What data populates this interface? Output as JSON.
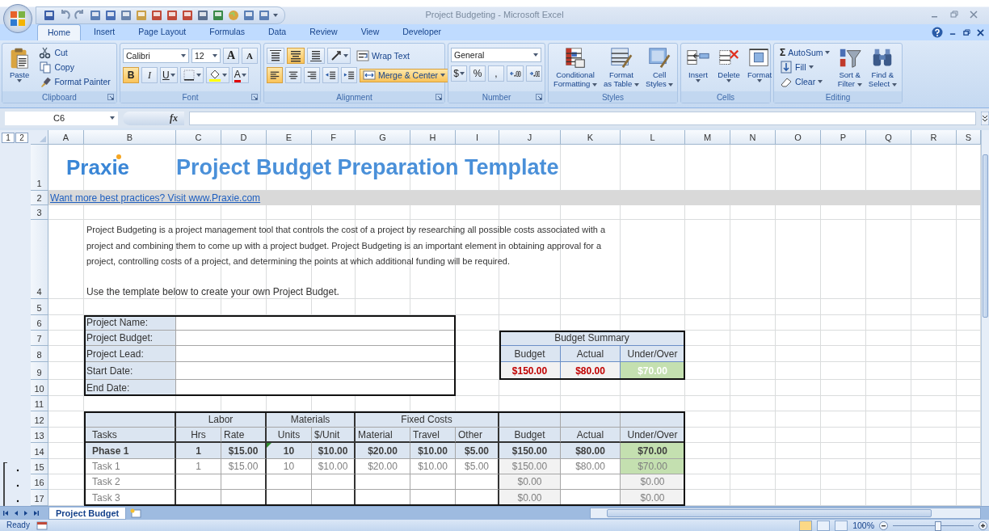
{
  "window": {
    "title": "Project Budgeting - Microsoft Excel"
  },
  "ribbon_tabs": [
    {
      "label": "Home",
      "selected": true
    },
    {
      "label": "Insert",
      "selected": false
    },
    {
      "label": "Page Layout",
      "selected": false
    },
    {
      "label": "Formulas",
      "selected": false
    },
    {
      "label": "Data",
      "selected": false
    },
    {
      "label": "Review",
      "selected": false
    },
    {
      "label": "View",
      "selected": false
    },
    {
      "label": "Developer",
      "selected": false
    }
  ],
  "ribbon": {
    "groups": [
      {
        "label": "Clipboard",
        "launcher": true,
        "sections": [
          [
            {
              "kind": "large",
              "lines": [
                "Paste"
              ],
              "dropdown": true
            }
          ],
          [
            {
              "kind": "small",
              "label": "Cut"
            },
            {
              "kind": "small",
              "label": "Copy"
            },
            {
              "kind": "small",
              "label": "Format Painter"
            }
          ]
        ]
      },
      {
        "label": "Font",
        "launcher": true,
        "sections": [
          [
            {
              "kind": "combo",
              "value": "Calibri"
            },
            {
              "kind": "combo",
              "value": "12"
            },
            {
              "kind": "glyph",
              "text": "A"
            },
            {
              "kind": "glyph",
              "text": "A"
            }
          ],
          [
            {
              "kind": "glyph",
              "text": "B",
              "selected": true
            },
            {
              "kind": "glyph",
              "text": "I",
              "selected": false
            },
            {
              "kind": "glyph",
              "text": "U",
              "selected": false,
              "dropdown": true
            },
            {
              "kind": "icon",
              "dropdown": true
            },
            {
              "kind": "icon",
              "dropdown": true
            },
            {
              "kind": "glyph",
              "text": "A",
              "dropdown": true
            }
          ]
        ]
      },
      {
        "label": "Alignment",
        "launcher": true,
        "sections": [
          [
            {
              "kind": "icon",
              "selected": false
            },
            {
              "kind": "icon",
              "selected": true
            },
            {
              "kind": "icon",
              "selected": false
            },
            {
              "kind": "icon",
              "dropdown": true
            },
            {
              "kind": "small",
              "label": "Wrap Text",
              "selected": false
            }
          ],
          [
            {
              "kind": "icon",
              "selected": true
            },
            {
              "kind": "icon",
              "selected": false
            },
            {
              "kind": "icon",
              "selected": false
            },
            {
              "kind": "icon"
            },
            {
              "kind": "icon"
            },
            {
              "kind": "small",
              "label": "Merge & Center",
              "selected": true,
              "dropdown": true
            }
          ]
        ]
      },
      {
        "label": "Number",
        "launcher": true,
        "sections": [
          [
            {
              "kind": "combo",
              "value": "General"
            }
          ],
          [
            {
              "kind": "glyph",
              "text": "$",
              "dropdown": true
            },
            {
              "kind": "glyph",
              "text": "%"
            },
            {
              "kind": "glyph",
              "text": ","
            },
            {
              "kind": "icon"
            },
            {
              "kind": "icon"
            }
          ]
        ]
      },
      {
        "label": "Styles",
        "launcher": false,
        "sections": [
          [
            {
              "kind": "large",
              "lines": [
                "Conditional",
                "Formatting"
              ],
              "dropdown": true
            }
          ],
          [
            {
              "kind": "large",
              "lines": [
                "Format",
                "as Table"
              ],
              "dropdown": true
            }
          ],
          [
            {
              "kind": "large",
              "lines": [
                "Cell",
                "Styles"
              ],
              "dropdown": true
            }
          ]
        ]
      },
      {
        "label": "Cells",
        "launcher": false,
        "sections": [
          [
            {
              "kind": "large",
              "lines": [
                "Insert"
              ],
              "dropdown": true
            }
          ],
          [
            {
              "kind": "large",
              "lines": [
                "Delete"
              ],
              "dropdown": true
            }
          ],
          [
            {
              "kind": "large",
              "lines": [
                "Format"
              ],
              "dropdown": true
            }
          ]
        ]
      },
      {
        "label": "Editing",
        "launcher": false,
        "sections": [
          [
            {
              "kind": "small",
              "glyph": "Σ",
              "label": "AutoSum",
              "dropdown": true
            },
            {
              "kind": "small",
              "label": "Fill",
              "dropdown": true
            },
            {
              "kind": "small",
              "label": "Clear",
              "dropdown": true
            }
          ],
          [
            {
              "kind": "large",
              "lines": [
                "Sort &",
                "Filter"
              ],
              "dropdown": true
            }
          ],
          [
            {
              "kind": "large",
              "lines": [
                "Find &",
                "Select"
              ],
              "dropdown": true
            }
          ]
        ]
      }
    ]
  },
  "formula_bar": {
    "name_box": "C6",
    "function_label": "fx"
  },
  "outline_levels": [
    "1",
    "2"
  ],
  "columns": [
    "A",
    "B",
    "C",
    "D",
    "E",
    "F",
    "G",
    "H",
    "I",
    "J",
    "K",
    "L",
    "M",
    "N",
    "O",
    "P",
    "Q",
    "R",
    "S"
  ],
  "rows": [
    "1",
    "2",
    "3",
    "4",
    "5",
    "6",
    "7",
    "8",
    "9",
    "10",
    "11",
    "12",
    "13",
    "14",
    "15",
    "16",
    "17"
  ],
  "sheet": {
    "logo": "Praxie",
    "title": "Project Budget Preparation Template",
    "link": "Want more best practices? Visit www.Praxie.com",
    "description": "Project Budgeting is a project management tool that controls the cost of a project by researching all possible costs associated with a project and combining them to come up with a project budget. Project Budgeting is an important element in obtaining approval for a project, controlling costs of a project, and determining the points at which additional funding will be required.",
    "instruction": "Use the template below to create your own Project Budget.",
    "project_fields": [
      "Project Name:",
      "Project Budget:",
      "Project Lead:",
      "Start Date:",
      "End Date:"
    ],
    "budget_summary": {
      "title": "Budget Summary",
      "headers": [
        "Budget",
        "Actual",
        "Under/Over"
      ],
      "values": [
        "$150.00",
        "$80.00",
        "$70.00"
      ],
      "under_budget": true
    },
    "table": {
      "header_groups": [
        "Labor",
        "Materials",
        "Fixed Costs"
      ],
      "columns": [
        "Tasks",
        "Hrs",
        "Rate",
        "Units",
        "$/Unit",
        "Material",
        "Travel",
        "Other",
        "Budget",
        "Actual",
        "Under/Over"
      ],
      "rows": [
        {
          "kind": "phase",
          "cells": [
            "Phase 1",
            "1",
            "$15.00",
            "10",
            "$10.00",
            "$20.00",
            "$10.00",
            "$5.00",
            "$150.00",
            "$80.00",
            "$70.00"
          ],
          "under_budget": true
        },
        {
          "kind": "task",
          "cells": [
            "Task 1",
            "1",
            "$15.00",
            "10",
            "$10.00",
            "$20.00",
            "$10.00",
            "$5.00",
            "$150.00",
            "$80.00",
            "$70.00"
          ],
          "under_budget": true
        },
        {
          "kind": "task",
          "cells": [
            "Task 2",
            null,
            null,
            null,
            null,
            null,
            null,
            null,
            "$0.00",
            null,
            "$0.00"
          ],
          "under_budget": false
        },
        {
          "kind": "task",
          "cells": [
            "Task 3",
            null,
            null,
            null,
            null,
            null,
            null,
            null,
            "$0.00",
            null,
            "$0.00"
          ],
          "under_budget": false
        }
      ]
    }
  },
  "sheet_tabs": [
    {
      "label": "Project Budget",
      "selected": true
    }
  ],
  "status_bar": {
    "status": "Ready",
    "zoom": {
      "label": "100%",
      "level": 0.55
    }
  }
}
